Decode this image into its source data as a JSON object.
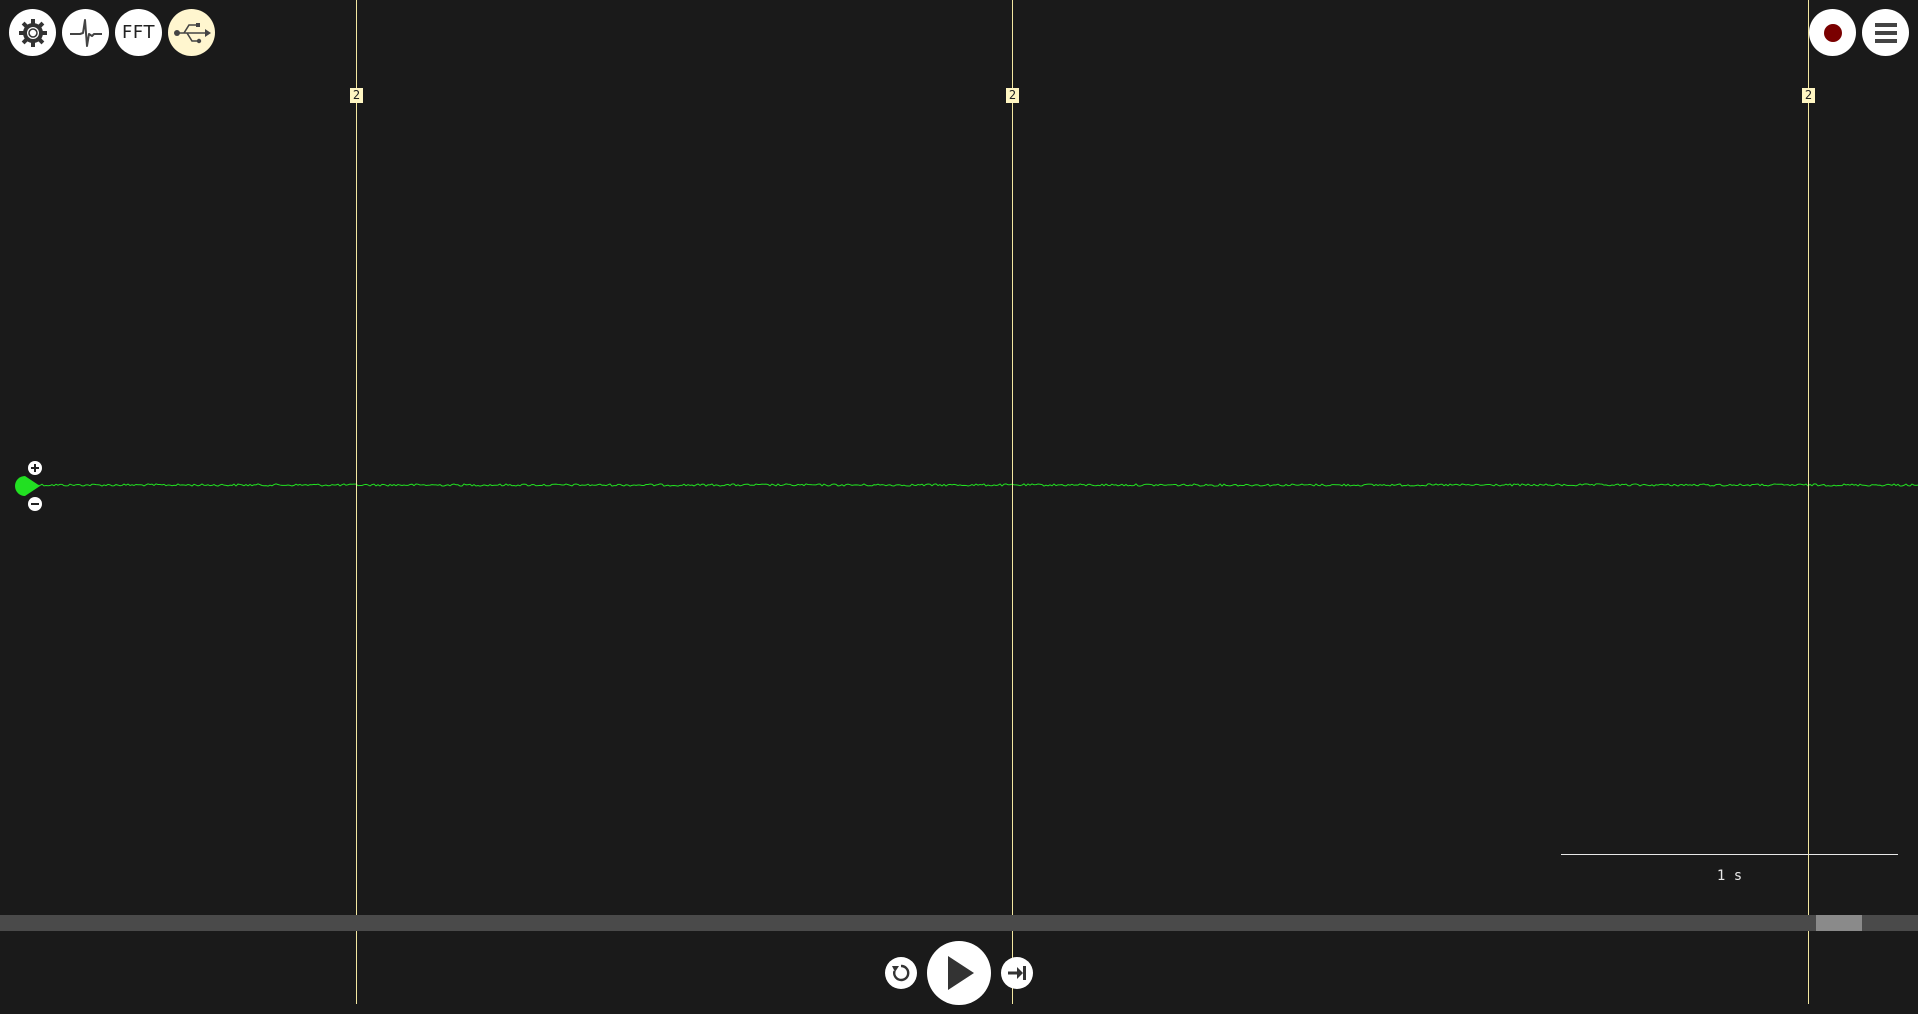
{
  "toolbar": {
    "left_buttons": [
      {
        "icon": "gear-icon",
        "action": "settings"
      },
      {
        "icon": "spike-waveform-icon",
        "action": "threshold"
      },
      {
        "icon": "fft-icon",
        "label": "FFT",
        "action": "fft"
      },
      {
        "icon": "usb-icon",
        "action": "usb-connection",
        "active": true
      }
    ],
    "right_buttons": [
      {
        "icon": "record-icon",
        "action": "record"
      },
      {
        "icon": "hamburger-menu-icon",
        "action": "menu"
      }
    ]
  },
  "markers": [
    {
      "label": "2"
    },
    {
      "label": "2"
    },
    {
      "label": "2"
    }
  ],
  "channel": {
    "color": "#22e022",
    "zoom_in_label": "+",
    "zoom_out_label": "−"
  },
  "scale": {
    "label": "1 s"
  },
  "timeline": {
    "position_fraction": 0.97
  },
  "playback": {
    "rewind_icon": "rewind-icon",
    "play_icon": "play-icon",
    "skip_end_icon": "skip-to-end-icon"
  },
  "colors": {
    "background": "#1a1a1a",
    "marker_line": "#f3e7a0",
    "marker_tag": "#fff6c2",
    "signal": "#22e022",
    "record_dot": "#7a0000",
    "active_button": "#fff6cf"
  }
}
